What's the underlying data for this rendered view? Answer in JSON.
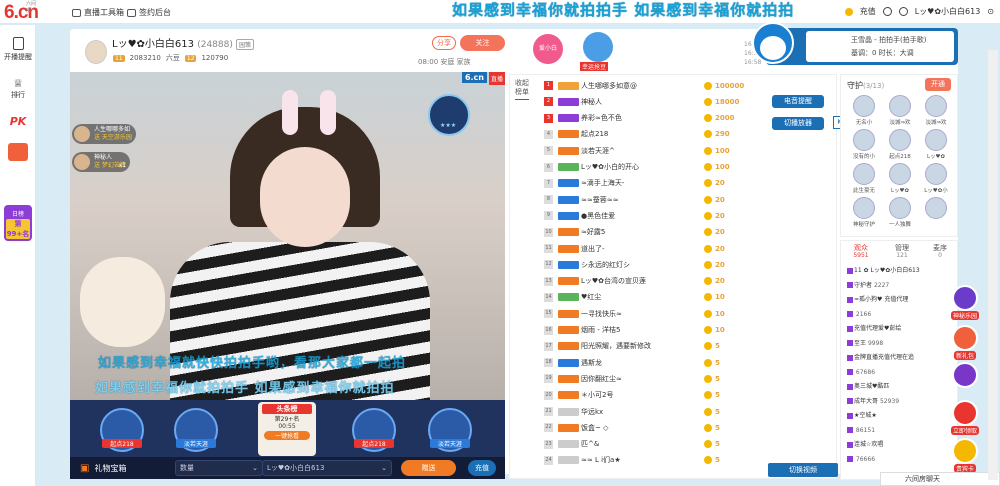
{
  "top": {
    "logo": "6.cn",
    "logo_sub": "六间房",
    "links": [
      "直播工具箱",
      "签约后台"
    ],
    "marquee": "如果感到幸福你就拍拍手 如果感到幸福你就拍拍",
    "recharge": "充值",
    "user": "Lッ♥✿小白白613"
  },
  "sidebar": {
    "items": [
      "开播提醒",
      "排行",
      "PK"
    ],
    "rank_label": "日榜",
    "rank_value": "第99+名"
  },
  "room": {
    "anchor_name": "Lッ♥✿小白白613",
    "anchor_id": "(24888)",
    "tag": "园策",
    "level": "11",
    "stat1": "2083210",
    "stat2": "六豆",
    "level2": "12",
    "stat3": "120790",
    "share": "分享",
    "follow": "关注",
    "meta": "08:00  安庭  家族",
    "badge1": "爱小白",
    "badge1_label": "",
    "badge2": "",
    "badge2_label": "幸运抢豆",
    "times": [
      "16:58",
      "16:58",
      "16:58"
    ],
    "song_line1": "王雪晶 - 拍拍手(拍手歌)",
    "song_line2": "基调：0      时长：大调"
  },
  "video": {
    "brand": "6.cn",
    "brand_tag": "直播",
    "pin_stars": "★★★",
    "users": [
      {
        "name": "人生哪哪多如",
        "sub": "送 天空游乐园"
      },
      {
        "name": "神秘人",
        "sub": "送 梦幻苦脾",
        "count": "x1"
      }
    ],
    "caption1": "如果感到幸福就快快拍拍手哟，看那大家都一起拍",
    "caption2": "如果感到幸福你就拍拍手 如果感到幸福你就拍拍"
  },
  "rank_strip": {
    "left_a": "起点218",
    "left_b": "淡若天涯",
    "center_title": "头条榜",
    "center_rank": "第29+名",
    "center_time": "00:55",
    "center_btn": "一键抢看",
    "right_a": "起点218",
    "right_b": "淡若天涯"
  },
  "bottom": {
    "gift_box": "礼物宝箱",
    "qty": "数量",
    "recipient": "Lッ♥✿小白白613",
    "send": "赠送",
    "recharge": "充值"
  },
  "contrib": {
    "tab": "收起榜单",
    "rows": [
      {
        "no": "1",
        "name": "人生哪哪多如意@",
        "val": "100000"
      },
      {
        "no": "2",
        "name": "神秘人",
        "val": "18000"
      },
      {
        "no": "3",
        "name": "养彩≈色不色",
        "val": "2000"
      },
      {
        "no": "4",
        "name": "起点218",
        "val": "290"
      },
      {
        "no": "5",
        "name": "淡若天涯^",
        "val": "100"
      },
      {
        "no": "6",
        "name": "Lッ♥✿小白的开心",
        "val": "100"
      },
      {
        "no": "7",
        "name": "≈滴手上海天-",
        "val": "20"
      },
      {
        "no": "8",
        "name": "≈≈蚕蓉≈≈",
        "val": "20"
      },
      {
        "no": "9",
        "name": "●黑色佳爱",
        "val": "20"
      },
      {
        "no": "10",
        "name": "≈好露5",
        "val": "20"
      },
      {
        "no": "11",
        "name": "道出了-",
        "val": "20"
      },
      {
        "no": "12",
        "name": "シ永远的红灯シ",
        "val": "20"
      },
      {
        "no": "13",
        "name": "Lッ♥✿台湾の宣贝莲",
        "val": "20"
      },
      {
        "no": "14",
        "name": "♥红尘",
        "val": "10"
      },
      {
        "no": "15",
        "name": "一寻找快乐≈",
        "val": "10"
      },
      {
        "no": "16",
        "name": "烟雨 - 洋桔5",
        "val": "10"
      },
      {
        "no": "17",
        "name": "阳光照耀，遇要新修改",
        "val": "5"
      },
      {
        "no": "18",
        "name": "遇斯龙",
        "val": "5"
      },
      {
        "no": "19",
        "name": "因你翻红尘≈",
        "val": "5"
      },
      {
        "no": "20",
        "name": "＊小可2号",
        "val": "5"
      },
      {
        "no": "21",
        "name": "华远kx",
        "val": "5"
      },
      {
        "no": "22",
        "name": "饭盒~ ◇",
        "val": "5"
      },
      {
        "no": "23",
        "name": "匹^&",
        "val": "5"
      },
      {
        "no": "24",
        "name": "≈≈ L i们a★",
        "val": "5"
      }
    ],
    "btn1": "电音提醒",
    "btn2": "切播放器",
    "k": "K",
    "chat_btn": "切换视频"
  },
  "guard": {
    "title": "守护",
    "count": "(3/13)",
    "open": "开通",
    "cells": [
      "无名小",
      "淡城⇒欢",
      "淡城⇒欢",
      "没有的小",
      "起点218",
      "Lッ♥✿",
      "此生豪无",
      "Lッ♥✿",
      "Lッ♥✿小",
      "神秘守护",
      "一人独舞",
      ""
    ]
  },
  "audience": {
    "tabs": [
      {
        "label": "观众",
        "count": "5951"
      },
      {
        "label": "管理",
        "count": "121"
      },
      {
        "label": "麦序",
        "count": "0"
      }
    ],
    "rows": [
      {
        "name": "11 ✿ Lッ♥✿小白白613",
        "count": ""
      },
      {
        "name": "守护者",
        "count": "2227"
      },
      {
        "name": "≈孤小狗♥ 充值代理",
        "count": ""
      },
      {
        "name": "",
        "count": "2166"
      },
      {
        "name": "充值代理爱♥彭绘",
        "count": ""
      },
      {
        "name": "至王",
        "count": "9998"
      },
      {
        "name": "金牌直播充值代理在追",
        "count": ""
      },
      {
        "name": "",
        "count": "67686"
      },
      {
        "name": "奥三城♥酷匹",
        "count": ""
      },
      {
        "name": "成年大哥",
        "count": "52939"
      },
      {
        "name": "★空城★",
        "count": ""
      },
      {
        "name": "",
        "count": "86151"
      },
      {
        "name": "连城☆欢唱",
        "count": ""
      },
      {
        "name": "",
        "count": "76666"
      }
    ]
  },
  "actions": [
    "神秘乐园",
    "新礼包",
    "",
    "立即领取",
    "贵宾卡"
  ],
  "footchat": "六间房聊天"
}
